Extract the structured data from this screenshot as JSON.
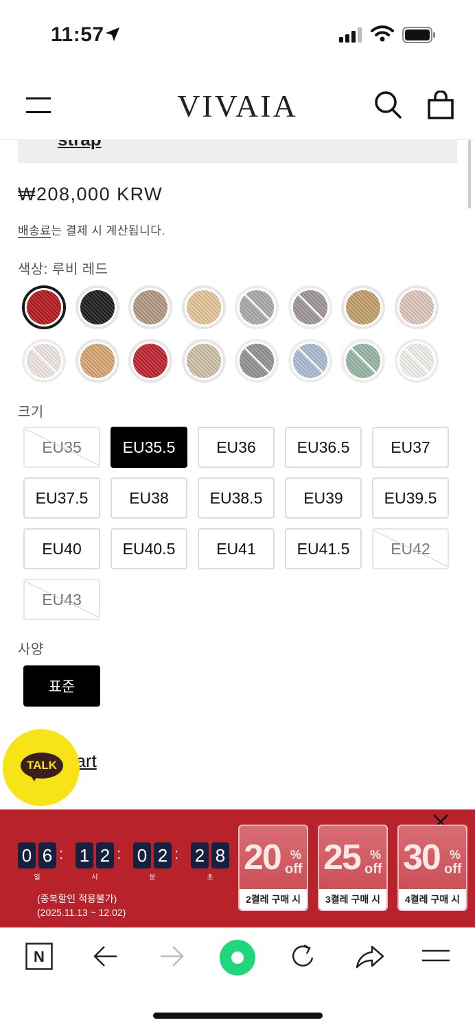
{
  "status_bar": {
    "time": "11:57"
  },
  "header": {
    "logo": "VIVAIA"
  },
  "partial_link": "strap",
  "product": {
    "price": "₩208,000 KRW",
    "shipping_link": "배송료",
    "shipping_rest": "는 결제 시 계산됩니다."
  },
  "color": {
    "label": "색상: 루비 레드",
    "swatches": [
      {
        "name": "ruby-red",
        "color": "#b8141c",
        "selected": true,
        "available": true
      },
      {
        "name": "black",
        "color": "#1b1b1b",
        "available": true
      },
      {
        "name": "tan-stripe",
        "color": "#b59a82",
        "available": true
      },
      {
        "name": "beige-black",
        "color": "#e7c898",
        "available": true
      },
      {
        "name": "grey-floral",
        "color": "#8a8a8a",
        "available": false
      },
      {
        "name": "grey-rose",
        "color": "#7a6e70",
        "available": false
      },
      {
        "name": "camel-knit",
        "color": "#c4a06a",
        "available": true
      },
      {
        "name": "blush-knit",
        "color": "#e2c8bd",
        "available": true
      },
      {
        "name": "pale-pink",
        "color": "#e9dcd6",
        "available": false
      },
      {
        "name": "sand",
        "color": "#d9a872",
        "available": true
      },
      {
        "name": "red-drop",
        "color": "#c2202e",
        "available": true
      },
      {
        "name": "ivory-drop",
        "color": "#cfc3aa",
        "available": true
      },
      {
        "name": "grey-drop",
        "color": "#6a6a6a",
        "available": false
      },
      {
        "name": "denim",
        "color": "#8ca2c2",
        "available": false
      },
      {
        "name": "sage",
        "color": "#6f9a82",
        "available": false
      },
      {
        "name": "white-mesh",
        "color": "#ece9e3",
        "available": false
      }
    ]
  },
  "size": {
    "label": "크기",
    "options": [
      {
        "label": "EU35",
        "state": "na"
      },
      {
        "label": "EU35.5",
        "state": "selected"
      },
      {
        "label": "EU36",
        "state": "ok"
      },
      {
        "label": "EU36.5",
        "state": "ok"
      },
      {
        "label": "EU37",
        "state": "ok"
      },
      {
        "label": "EU37.5",
        "state": "ok"
      },
      {
        "label": "EU38",
        "state": "ok"
      },
      {
        "label": "EU38.5",
        "state": "ok"
      },
      {
        "label": "EU39",
        "state": "ok"
      },
      {
        "label": "EU39.5",
        "state": "ok"
      },
      {
        "label": "EU40",
        "state": "ok"
      },
      {
        "label": "EU40.5",
        "state": "ok"
      },
      {
        "label": "EU41",
        "state": "ok"
      },
      {
        "label": "EU41.5",
        "state": "ok"
      },
      {
        "label": "EU42",
        "state": "na"
      },
      {
        "label": "EU43",
        "state": "na"
      }
    ]
  },
  "spec": {
    "label": "사양",
    "option": "표준"
  },
  "size_chart_link": "nart",
  "talk": {
    "label": "TALK"
  },
  "promo": {
    "timer": {
      "days": [
        "0",
        "6"
      ],
      "hours": [
        "1",
        "2"
      ],
      "minutes": [
        "0",
        "2"
      ],
      "seconds": [
        "2",
        "8"
      ],
      "units": [
        "일",
        "시",
        "분",
        "초"
      ]
    },
    "note_line1": "(중복할인 적용불가)",
    "note_line2": "(2025.11.13 ~ 12.02)",
    "cards": [
      {
        "pct": "20",
        "sign": "%",
        "off": "off",
        "foot": "2켤레 구매 시"
      },
      {
        "pct": "25",
        "sign": "%",
        "off": "off",
        "foot": "3켤레 구매 시"
      },
      {
        "pct": "30",
        "sign": "%",
        "off": "off",
        "foot": "4켤레 구매 시"
      }
    ]
  },
  "toolbar": {
    "home_letter": "N"
  }
}
